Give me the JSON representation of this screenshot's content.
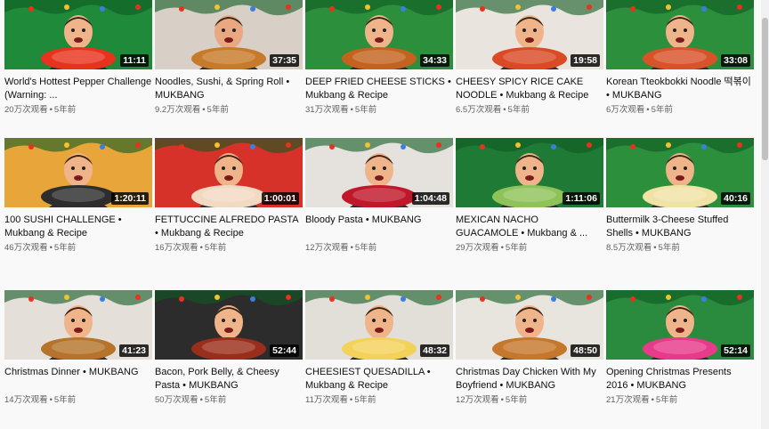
{
  "videos": [
    {
      "title": "World's Hottest Pepper Challenge (Warning: ...",
      "duration": "11:11",
      "views": "20万次观看",
      "age": "5年前",
      "thumb": {
        "bg": "#1f8a3a",
        "accent": "#e8321e",
        "skin": "#f0b48a"
      }
    },
    {
      "title": "Noodles, Sushi, & Spring Roll • MUKBANG",
      "duration": "37:35",
      "views": "9.2万次观看",
      "age": "5年前",
      "thumb": {
        "bg": "#d8cfc6",
        "accent": "#c77a2a",
        "skin": "#e9a882"
      }
    },
    {
      "title": "DEEP FRIED CHEESE STICKS • Mukbang & Recipe",
      "duration": "34:33",
      "views": "31万次观看",
      "age": "5年前",
      "thumb": {
        "bg": "#2c8f3c",
        "accent": "#c4621f",
        "skin": "#f0b48a"
      }
    },
    {
      "title": "CHEESY SPICY RICE CAKE NOODLE • Mukbang & Recipe",
      "duration": "19:58",
      "views": "6.5万次观看",
      "age": "5年前",
      "thumb": {
        "bg": "#e9e4dd",
        "accent": "#d94a25",
        "skin": "#f0b48a"
      }
    },
    {
      "title": "Korean Tteokbokki Noodle 떡볶이 • MUKBANG",
      "duration": "33:08",
      "views": "6万次观看",
      "age": "5年前",
      "thumb": {
        "bg": "#2c8f3c",
        "accent": "#d8522a",
        "skin": "#f0b48a"
      }
    },
    {
      "title": "100 SUSHI CHALLENGE • Mukbang & Recipe",
      "duration": "1:20:11",
      "views": "46万次观看",
      "age": "5年前",
      "thumb": {
        "bg": "#e8a63a",
        "accent": "#2d2d2d",
        "skin": "#f0b48a"
      }
    },
    {
      "title": "FETTUCCINE ALFREDO PASTA • Mukbang & Recipe",
      "duration": "1:00:01",
      "views": "16万次观看",
      "age": "5年前",
      "thumb": {
        "bg": "#d7322a",
        "accent": "#f2d9c2",
        "skin": "#f0b48a"
      }
    },
    {
      "title": "Bloody Pasta • MUKBANG",
      "duration": "1:04:48",
      "views": "12万次观看",
      "age": "5年前",
      "thumb": {
        "bg": "#e5e1dc",
        "accent": "#c0182a",
        "skin": "#f0b48a"
      }
    },
    {
      "title": "MEXICAN NACHO GUACAMOLE • Mukbang & ...",
      "duration": "1:11:06",
      "views": "29万次观看",
      "age": "5年前",
      "thumb": {
        "bg": "#1f7a36",
        "accent": "#8fc35a",
        "skin": "#f0b48a"
      }
    },
    {
      "title": "Buttermilk 3-Cheese Stuffed Shells • MUKBANG",
      "duration": "40:16",
      "views": "8.5万次观看",
      "age": "5年前",
      "thumb": {
        "bg": "#2c8f3c",
        "accent": "#f1e2a6",
        "skin": "#f0b48a"
      }
    },
    {
      "title": "Christmas Dinner • MUKBANG",
      "duration": "41:23",
      "views": "14万次观看",
      "age": "5年前",
      "thumb": {
        "bg": "#e4dfd8",
        "accent": "#b5742a",
        "skin": "#f0b48a"
      }
    },
    {
      "title": "Bacon, Pork Belly, & Cheesy Pasta • MUKBANG",
      "duration": "52:44",
      "views": "50万次观看",
      "age": "5年前",
      "thumb": {
        "bg": "#2c2c2c",
        "accent": "#9a2e1c",
        "skin": "#f0b48a"
      }
    },
    {
      "title": "CHEESIEST QUESADILLA • Mukbang & Recipe",
      "duration": "48:32",
      "views": "11万次观看",
      "age": "5年前",
      "thumb": {
        "bg": "#e2ded8",
        "accent": "#f3d25a",
        "skin": "#f0b48a"
      }
    },
    {
      "title": "Christmas Day Chicken With My Boyfriend • MUKBANG",
      "duration": "48:50",
      "views": "12万次观看",
      "age": "5年前",
      "thumb": {
        "bg": "#e8e4de",
        "accent": "#c5782c",
        "skin": "#f0b48a"
      }
    },
    {
      "title": "Opening Christmas Presents 2016 • MUKBANG",
      "duration": "52:14",
      "views": "21万次观看",
      "age": "5年前",
      "thumb": {
        "bg": "#2a8a3e",
        "accent": "#e83a8a",
        "skin": "#f0b48a"
      }
    }
  ]
}
